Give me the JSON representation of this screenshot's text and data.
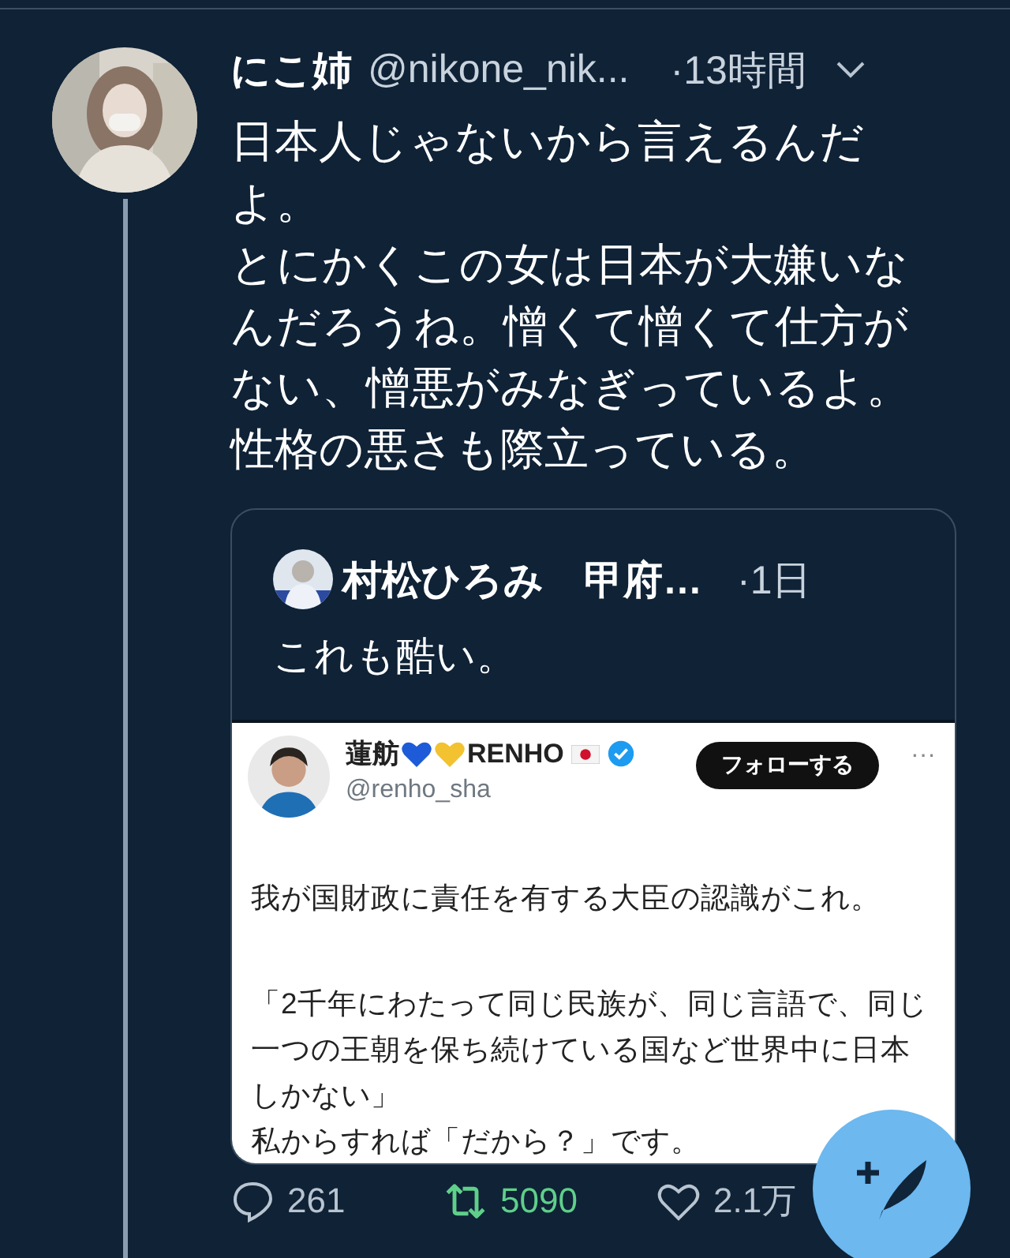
{
  "tweet": {
    "display_name": "にこ姉",
    "handle": "@nikone_nik...",
    "time": "·13時間",
    "text": [
      "日本人じゃないから言えるんだよ。",
      "とにかくこの女は日本が大嫌いなんだろうね。憎くて憎くて仕方がない、憎悪がみなぎっているよ。",
      "性格の悪さも際立っている。"
    ],
    "quote": {
      "display_name": "村松ひろみ　甲府…",
      "time": "·1日",
      "text": "これも酷い。",
      "embedded": {
        "display_name": "蓮舫",
        "name_suffix": "RENHO",
        "verified": true,
        "handle": "@renho_sha",
        "follow_label": "フォローする",
        "more": "···",
        "text": [
          "我が国財政に責任を有する大臣の認識がこれ。",
          "「2千年にわたって同じ民族が、同じ言語で、同じ一つの王朝を保ち続けている国など世界中に日本しかない」",
          "私からすれば「だから？」です。"
        ]
      }
    },
    "actions": [
      {
        "kind": "reply",
        "count": "261",
        "active": false
      },
      {
        "kind": "retweet",
        "count": "5090",
        "active": true
      },
      {
        "kind": "like",
        "count": "2.1万",
        "active": false
      }
    ]
  }
}
